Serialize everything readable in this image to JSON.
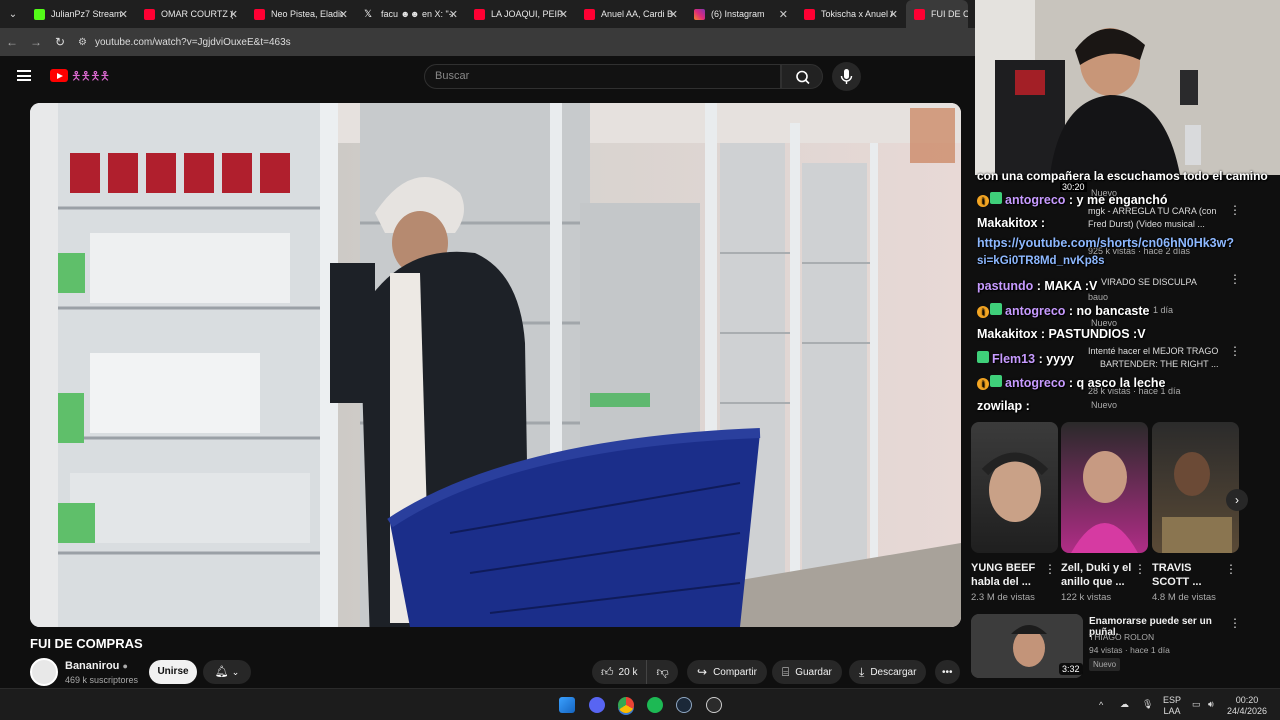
{
  "browser": {
    "tabs": [
      {
        "title": "JulianPz7 Stream",
        "color": "#53fc18"
      },
      {
        "title": "OMAR COURTZ (Ja",
        "color": "#ff0033"
      },
      {
        "title": "Neo Pistea, Eladio",
        "color": "#ff0033"
      },
      {
        "title": "facu ☻☻ en X: \"-ab",
        "color": "#ffffff"
      },
      {
        "title": "LA JOAQUI, PEIPP",
        "color": "#ff0033"
      },
      {
        "title": "Anuel AA, Cardi B",
        "color": "#ff0033"
      },
      {
        "title": "(6) Instagram",
        "color": "#d6249f"
      },
      {
        "title": "Tokischa x Anuel A",
        "color": "#ff0033"
      },
      {
        "title": "FUI DE COM",
        "color": "#ff0033"
      }
    ],
    "url": "youtube.com/watch?v=JgjdviOuxeE&t=463s"
  },
  "header": {
    "search_placeholder": "Buscar"
  },
  "video": {
    "title": "FUI DE COMPRAS",
    "channel": "Bananirou",
    "subscribers": "469 k suscriptores",
    "join": "Unirse",
    "likes": "20 k",
    "share": "Compartir",
    "save": "Guardar",
    "download": "Descargar"
  },
  "chat": [
    {
      "text": "con una compañera la escuchamos todo el camino"
    },
    {
      "user": "antogreco",
      "msg": " : y me enganchó"
    },
    {
      "user": "Makakitox",
      "msg": " :"
    },
    {
      "link1": "https://youtube.com/shorts/cn06hN0Hk3w?"
    },
    {
      "link2": "si=kGi0TR8Md_nvKp8s"
    },
    {
      "user": "pastundo",
      "msg": " : MAKA :V"
    },
    {
      "user": "antogreco",
      "msg": " : no bancaste"
    },
    {
      "user": "Makakitox",
      "msg": " : PASTUNDIOS :V"
    },
    {
      "user": "Flem13",
      "msg": " : yyyy"
    },
    {
      "user": "antogreco",
      "msg": " : q asco la leche"
    },
    {
      "user": "zowilap",
      "msg": " :"
    }
  ],
  "hidden_recs": {
    "r1_time": "30:20",
    "r1_badge": "Nuevo",
    "r2_title": "mgk - ARREGLA TU CARA (con",
    "r2_title2": "Fred Durst) (Video musical ...",
    "r2_meta": "925 k vistas · hace 2 días",
    "r3_title": "VIRADO SE DISCULPA",
    "r3_channel": "bauo",
    "r3_meta": "1 día",
    "r3_badge": "Nuevo",
    "r4_title": "Intenté hacer el MEJOR TRAGO",
    "r4_title2": "BARTENDER: THE RIGHT ...",
    "r4_meta": "28 k vistas · hace 1 día",
    "r4_badge": "Nuevo"
  },
  "shorts": [
    {
      "title": "YUNG BEEF habla del ...",
      "views": "2.3 M de vistas"
    },
    {
      "title": "Zell, Duki y el anillo que ...",
      "views": "122 k vistas"
    },
    {
      "title": "TRAVIS SCOTT ...",
      "views": "4.8 M de vistas"
    }
  ],
  "rec_video": {
    "title": "Enamorarse puede ser un puñal.",
    "channel": "THIAGO ROLON",
    "meta": "94 vistas · hace 1 día",
    "badge": "Nuevo",
    "duration": "3:32"
  },
  "taskbar": {
    "lang": "ESP",
    "lang2": "LAA",
    "time": "00:20",
    "date": "24/4/2026"
  }
}
